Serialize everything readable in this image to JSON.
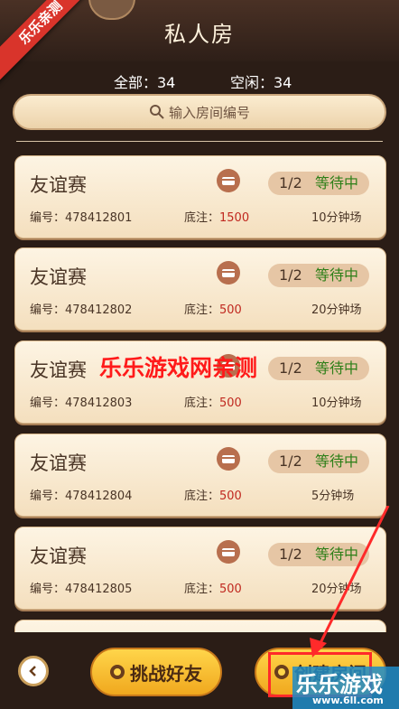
{
  "header": {
    "title": "私人房",
    "ribbon": "乐乐亲测",
    "total_label": "全部：34",
    "idle_label": "空闲：34"
  },
  "search": {
    "placeholder": "输入房间编号"
  },
  "rooms": [
    {
      "name": "友谊赛",
      "players": "1/2",
      "status": "等待中",
      "id": "编号：478412801",
      "bet_label": "底注：",
      "bet": "1500",
      "duration": "10分钟场"
    },
    {
      "name": "友谊赛",
      "players": "1/2",
      "status": "等待中",
      "id": "编号：478412802",
      "bet_label": "底注：",
      "bet": "500",
      "duration": "20分钟场"
    },
    {
      "name": "友谊赛",
      "players": "1/2",
      "status": "等待中",
      "id": "编号：478412803",
      "bet_label": "底注：",
      "bet": "500",
      "duration": "10分钟场"
    },
    {
      "name": "友谊赛",
      "players": "1/2",
      "status": "等待中",
      "id": "编号：478412804",
      "bet_label": "底注：",
      "bet": "500",
      "duration": "5分钟场"
    },
    {
      "name": "友谊赛",
      "players": "1/2",
      "status": "等待中",
      "id": "编号：478412805",
      "bet_label": "底注：",
      "bet": "500",
      "duration": "20分钟场"
    }
  ],
  "footer": {
    "challenge_label": "挑战好友",
    "create_label": "创建房间"
  },
  "watermark": {
    "overlay": "乐乐游戏网亲测",
    "brand": "乐乐游戏",
    "brand_url": "www.6ll.com"
  },
  "colors": {
    "accent": "#ffd54a",
    "status": "#2d7f18",
    "bet": "#c0281f",
    "highlight": "#ff2a2a"
  }
}
